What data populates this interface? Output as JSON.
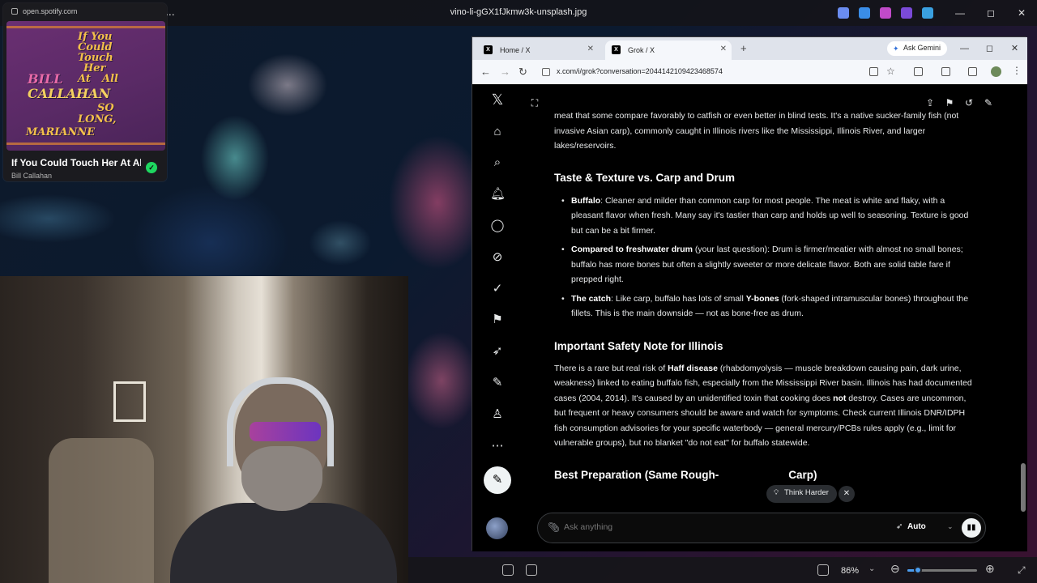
{
  "viewer": {
    "title": "vino-li-gGX1fJkmw3k-unsplash.jpg",
    "more_icon": "...",
    "minimize": "—",
    "maximize": "◻",
    "close": "✕",
    "zoom_level": "86%"
  },
  "spotify": {
    "url": "open.spotify.com",
    "album_art_text": [
      "If You",
      "Could",
      "Touch",
      "Her",
      "At",
      "All",
      "BILL",
      "CALLAHAN",
      "SO",
      "LONG,",
      "MARIANNE"
    ],
    "track_title": "If You Could Touch Her At All",
    "artist": "Bill Callahan"
  },
  "browser": {
    "tabs": [
      {
        "label": "Home / X",
        "favicon": "X"
      },
      {
        "label": "Grok / X",
        "favicon": "X"
      }
    ],
    "new_tab": "+",
    "gemini_label": "Ask Gemini",
    "url": "x.com/i/grok?conversation=2044142109423468574",
    "window_controls": {
      "minimize": "—",
      "maximize": "◻",
      "close": "✕"
    }
  },
  "sidebar": {
    "logo": "𝕏",
    "items": [
      {
        "name": "home-icon",
        "glyph": "⌂"
      },
      {
        "name": "search-icon",
        "glyph": "⌕"
      },
      {
        "name": "notifications-icon",
        "glyph": "🔔︎"
      },
      {
        "name": "messages-icon",
        "glyph": "◯"
      },
      {
        "name": "grok-icon",
        "glyph": "⊘"
      },
      {
        "name": "premium-icon",
        "glyph": "✓"
      },
      {
        "name": "bookmarks-icon",
        "glyph": "⚑"
      },
      {
        "name": "jobs-icon",
        "glyph": "➶"
      },
      {
        "name": "articles-icon",
        "glyph": "✎"
      },
      {
        "name": "profile-icon",
        "glyph": "♙"
      },
      {
        "name": "more-icon",
        "glyph": "⋯"
      }
    ]
  },
  "content": {
    "intro": "meat that some compare favorably to catfish or even better in blind tests. It's a native sucker-family fish (not invasive Asian carp), commonly caught in Illinois rivers like the Mississippi, Illinois River, and larger lakes/reservoirs.",
    "section1": {
      "heading": "Taste & Texture vs. Carp and Drum",
      "bullets": [
        {
          "bold": "Buffalo",
          "text": ": Cleaner and milder than common carp for most people. The meat is white and flaky, with a pleasant flavor when fresh. Many say it's tastier than carp and holds up well to seasoning. Texture is good but can be a bit firmer."
        },
        {
          "bold": "Compared to freshwater drum",
          "text": " (your last question): Drum is firmer/meatier with almost no small bones; buffalo has more bones but often a slightly sweeter or more delicate flavor. Both are solid table fare if prepped right."
        },
        {
          "bold": "The catch",
          "text": ": Like carp, buffalo has lots of small ",
          "bold2": "Y-bones",
          "text2": " (fork-shaped intramuscular bones) throughout the fillets. This is the main downside — not as bone-free as drum."
        }
      ]
    },
    "section2": {
      "heading": "Important Safety Note for Illinois",
      "p_a": "There is a rare but real risk of ",
      "p_b": "Haff disease",
      "p_c": " (rhabdomyolysis — muscle breakdown causing pain, dark urine, weakness) linked to eating buffalo fish, especially from the Mississippi River basin. Illinois has had documented cases (2004, 2014). It's caused by an unidentified toxin that cooking does ",
      "p_d": "not",
      "p_e": " destroy. Cases are uncommon, but frequent or heavy consumers should be aware and watch for symptoms. Check current Illinois DNR/IDPH fish consumption advisories for your specific waterbody — general mercury/PCBs rules apply (e.g., limit for vulnerable groups), but no blanket \"do not eat\" for buffalo statewide."
    },
    "section3": {
      "heading_left": "Best Preparation (Same Rough-",
      "heading_right": "Carp)"
    },
    "think_harder": "Think Harder",
    "composer_placeholder": "Ask anything",
    "mode": "Auto"
  }
}
